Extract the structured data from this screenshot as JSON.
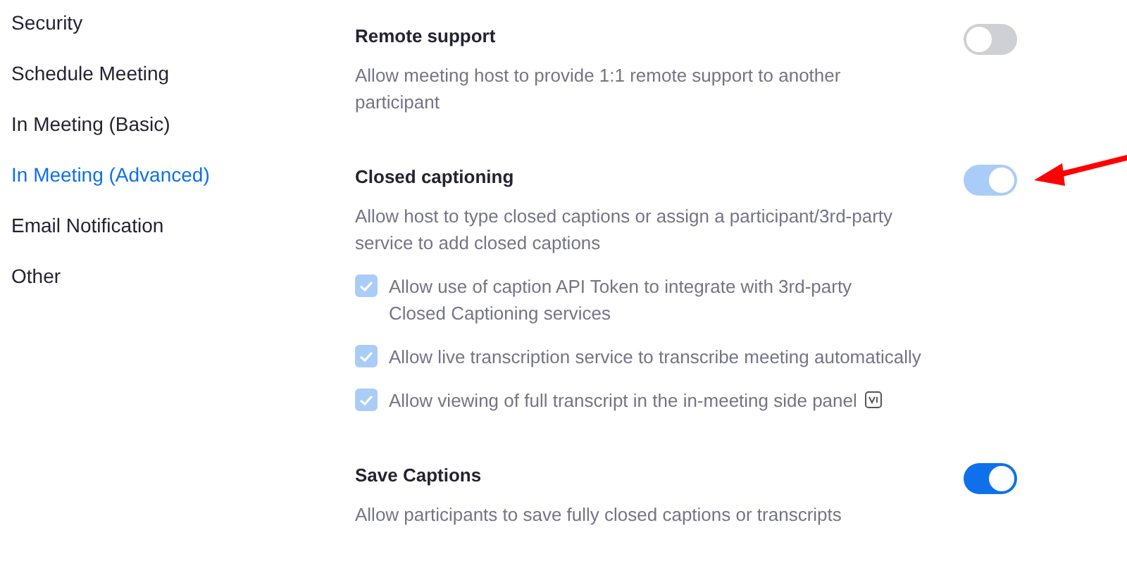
{
  "sidebar": {
    "items": [
      {
        "label": "Security",
        "selected": false
      },
      {
        "label": "Schedule Meeting",
        "selected": false
      },
      {
        "label": "In Meeting (Basic)",
        "selected": false
      },
      {
        "label": "In Meeting (Advanced)",
        "selected": true
      },
      {
        "label": "Email Notification",
        "selected": false
      },
      {
        "label": "Other",
        "selected": false
      }
    ]
  },
  "settings": [
    {
      "title": "Remote support",
      "description": "Allow meeting host to provide 1:1 remote support to another participant",
      "toggle": {
        "on": false,
        "disabled": false
      }
    },
    {
      "title": "Closed captioning",
      "description": "Allow host to type closed captions or assign a participant/3rd-party service to add closed captions",
      "toggle": {
        "on": true,
        "disabled": true
      },
      "annotated": true,
      "options": [
        {
          "label": "Allow use of caption API Token to integrate with 3rd-party Closed Captioning services",
          "kind": "plain",
          "checked": true,
          "disabled": true
        },
        {
          "label": "Allow live transcription service to transcribe meeting automatically",
          "kind": "plain",
          "checked": true,
          "disabled": true
        },
        {
          "label": "Allow viewing of full transcript in the in-meeting side panel",
          "kind": "info",
          "checked": true,
          "disabled": true
        }
      ]
    },
    {
      "title": "Save Captions",
      "description": "Allow participants to save fully closed captions or transcripts",
      "toggle": {
        "on": true,
        "disabled": false
      }
    }
  ]
}
